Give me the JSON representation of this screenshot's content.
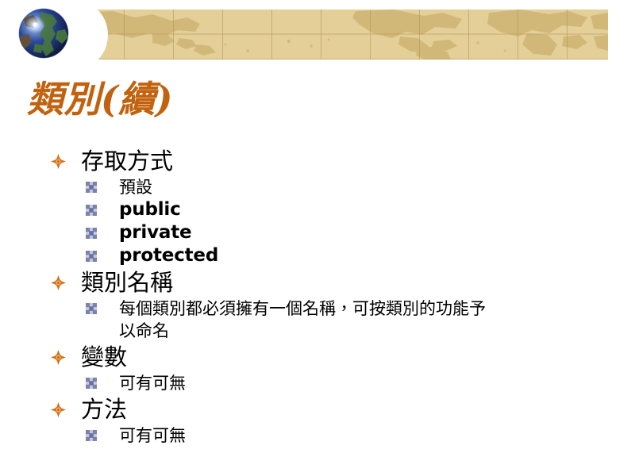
{
  "slide": {
    "title": "類別(續)",
    "title_color": "#c1620e",
    "band_color": "#e3cf97",
    "band_land_color": "#d2b878",
    "bullet1_color": "#d2721a",
    "bullet2_color": "#7b82ab"
  },
  "header": {
    "globe_icon": "globe-icon",
    "band_texture": "world-map-texture"
  },
  "outline": [
    {
      "label": "存取方式",
      "children": [
        {
          "label": "預設",
          "script": "han"
        },
        {
          "label": "public",
          "script": "latin"
        },
        {
          "label": "private",
          "script": "latin"
        },
        {
          "label": "protected",
          "script": "latin"
        }
      ]
    },
    {
      "label": "類別名稱",
      "children": [
        {
          "label": "每個類別都必須擁有一個名稱，可按類別的功能予",
          "line2": "以命名",
          "script": "han"
        }
      ]
    },
    {
      "label": "變數",
      "children": [
        {
          "label": "可有可無",
          "script": "han"
        }
      ]
    },
    {
      "label": "方法",
      "children": [
        {
          "label": "可有可無",
          "script": "han"
        }
      ]
    }
  ]
}
